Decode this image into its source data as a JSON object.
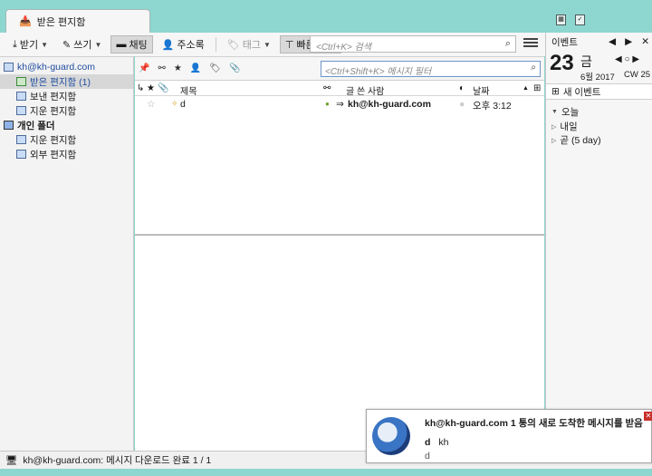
{
  "tab": {
    "label": "받은 편지함"
  },
  "toolbar": {
    "get_label": "받기",
    "write_label": "쓰기",
    "chat_label": "채팅",
    "addressbook_label": "주소록",
    "tag_label": "태그",
    "quickfilter_label": "빠른 필터",
    "search_placeholder": "<Ctrl+K> 검색"
  },
  "folders": {
    "account": "kh@kh-guard.com",
    "inbox": "받은 편지함 (1)",
    "sent": "보낸 편지함",
    "trash": "지운 편지함",
    "local_root": "개인 폴더",
    "local_trash": "지운 편지함",
    "outbox": "외부 편지함"
  },
  "list": {
    "filter_placeholder": "<Ctrl+Shift+K> 메시지 필터",
    "col_subject": "제목",
    "col_sender": "글 쓴 사람",
    "col_date": "날짜",
    "rows": [
      {
        "subject": "d",
        "sender": "kh@kh-guard.com",
        "date": "오후 3:12"
      }
    ]
  },
  "today": {
    "events_label": "이벤트",
    "day": "23",
    "weekday": "금",
    "month_year": "6월 2017",
    "cw": "CW 25",
    "new_event": "새 이벤트",
    "cat_today": "오늘",
    "cat_tomorrow": "내일",
    "cat_soon": "곧 (5 day)"
  },
  "status": {
    "text": "kh@kh-guard.com: 메시지 다운로드 완료 1 / 1"
  },
  "notification": {
    "title": "kh@kh-guard.com 1 통의 새로 도착한 메시지를 받음",
    "subject": "d",
    "from": "kh",
    "preview": "d"
  }
}
